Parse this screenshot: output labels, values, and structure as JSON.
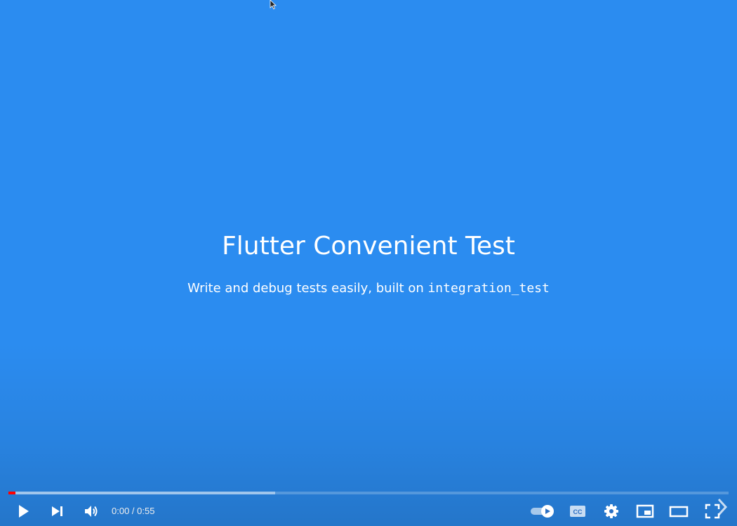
{
  "slide": {
    "title": "Flutter Convenient Test",
    "subtitle_text": "Write and debug tests easily, built on ",
    "subtitle_code": "integration_test"
  },
  "player": {
    "current_time": "0:00",
    "separator": " / ",
    "duration": "0:55",
    "progress_played_fraction": 0.0,
    "progress_loaded_fraction": 0.37,
    "colors": {
      "background": "#2b8cf0",
      "played": "#ff0000",
      "icon": "#ffffff"
    },
    "icons": [
      "play-icon",
      "next-icon",
      "volume-icon",
      "autoplay-toggle-icon",
      "captions-icon",
      "settings-icon",
      "miniplayer-icon",
      "theater-icon",
      "fullscreen-icon",
      "next-chevron-icon"
    ]
  }
}
